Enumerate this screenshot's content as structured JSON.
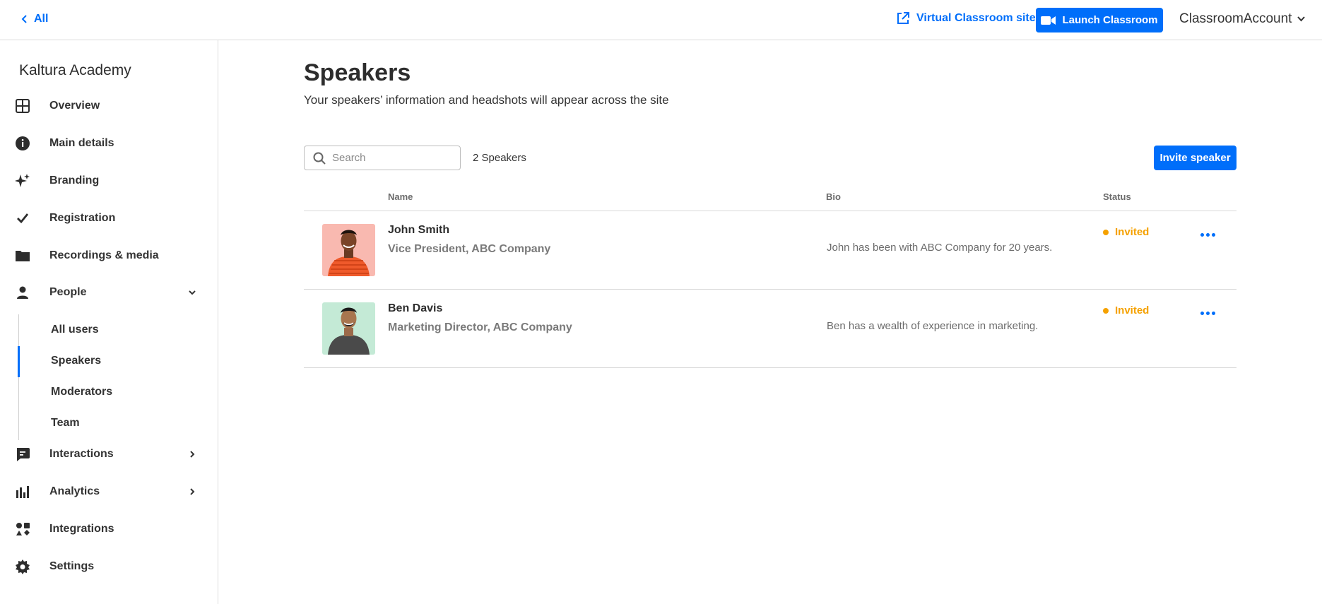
{
  "topbar": {
    "back_label": "All",
    "virtual_classroom_label": "Virtual Classroom site",
    "launch_label": "Launch Classroom",
    "account_label": "ClassroomAccount"
  },
  "sidebar": {
    "org_name": "Kaltura Academy",
    "items": [
      {
        "label": "Overview",
        "icon": "grid-icon"
      },
      {
        "label": "Main details",
        "icon": "info-icon"
      },
      {
        "label": "Branding",
        "icon": "sparkle-icon"
      },
      {
        "label": "Registration",
        "icon": "check-icon"
      },
      {
        "label": "Recordings & media",
        "icon": "folder-icon"
      },
      {
        "label": "People",
        "icon": "person-icon"
      },
      {
        "label": "Interactions",
        "icon": "chat-icon"
      },
      {
        "label": "Analytics",
        "icon": "bar-chart-icon"
      },
      {
        "label": "Integrations",
        "icon": "integrations-icon"
      },
      {
        "label": "Settings",
        "icon": "gear-icon"
      }
    ],
    "people_sub": [
      {
        "label": "All users"
      },
      {
        "label": "Speakers",
        "active": true
      },
      {
        "label": "Moderators"
      },
      {
        "label": "Team"
      }
    ]
  },
  "main": {
    "title": "Speakers",
    "subtitle": "Your speakers’ information and headshots will appear across the site",
    "search_placeholder": "Search",
    "count_label": "2 Speakers",
    "invite_label": "Invite speaker",
    "columns": {
      "name": "Name",
      "bio": "Bio",
      "status": "Status"
    },
    "speakers": [
      {
        "name": "John Smith",
        "role": "Vice President, ABC Company",
        "bio": "John has been with ABC Company for 20 years.",
        "status": "Invited"
      },
      {
        "name": "Ben Davis",
        "role": "Marketing Director, ABC Company",
        "bio": "Ben has a wealth of experience in marketing.",
        "status": "Invited"
      }
    ]
  },
  "colors": {
    "accent": "#006efa",
    "status_invited": "#f5a100",
    "avatar_bg_1": "#f9b9b0",
    "avatar_bg_2": "#c4ead6"
  }
}
